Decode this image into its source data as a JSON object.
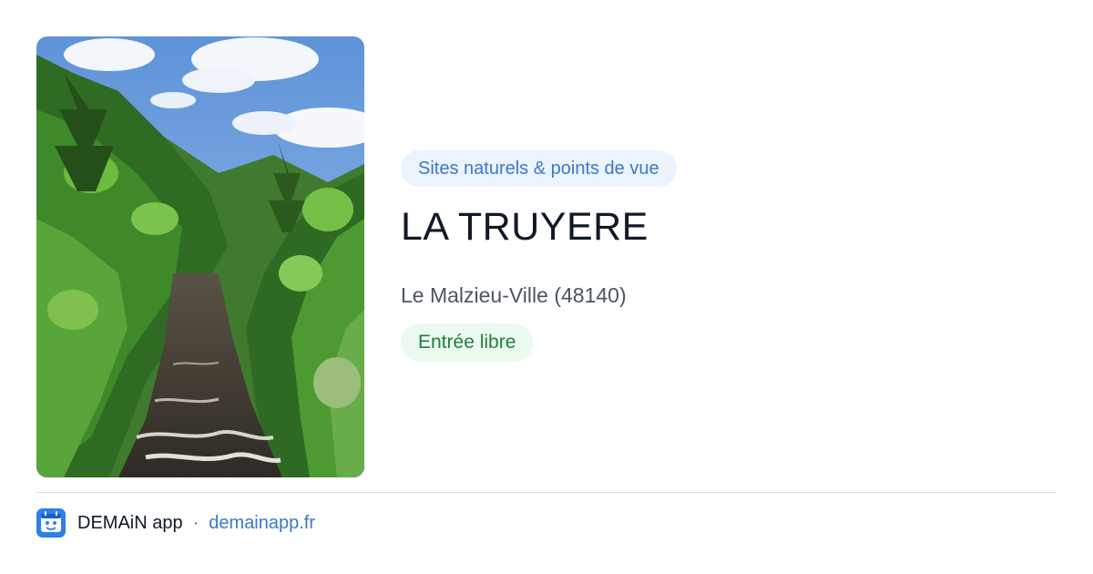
{
  "hero_image": {
    "subject": "river-gorge-photo"
  },
  "category_tag": "Sites naturels & points de vue",
  "title": "LA TRUYERE",
  "location": "Le Malzieu-Ville (48140)",
  "access_badge": "Entrée libre",
  "footer": {
    "app_icon": "demain-app-icon",
    "app_name": "DEMAiN app",
    "separator": "·",
    "site_url": "demainapp.fr"
  },
  "colors": {
    "tag_bg": "#ecf3fc",
    "tag_text": "#3b79c9",
    "badge_bg": "#ecf9ef",
    "badge_text": "#20803f",
    "link": "#3b79c9",
    "app_icon_bg": "#2f80e8"
  }
}
